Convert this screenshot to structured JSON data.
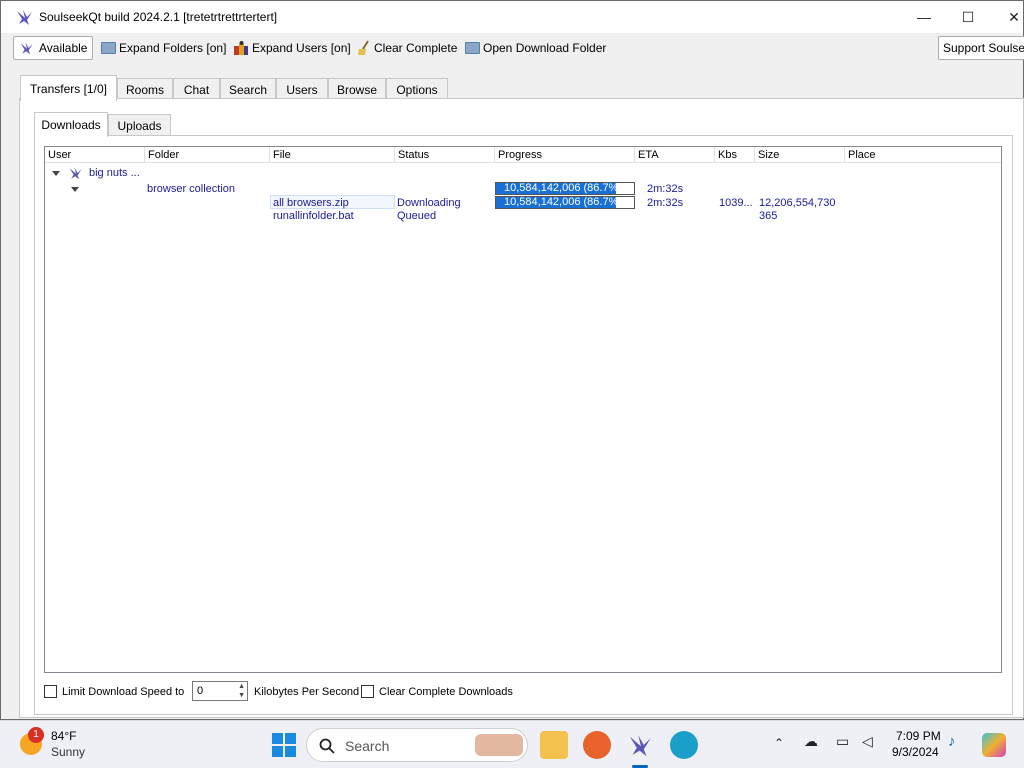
{
  "window": {
    "title": "SoulseekQt build 2024.2.1 [tretetrtrettrtertert]",
    "minimize": "—",
    "maximize": "☐",
    "close": "✕"
  },
  "toolbar": {
    "available": "Available",
    "expand_folders": "Expand Folders [on]",
    "expand_users": "Expand Users [on]",
    "clear_complete": "Clear Complete",
    "open_download_folder": "Open Download Folder",
    "support": "Support Soulseek"
  },
  "tabs": [
    "Transfers [1/0]",
    "Rooms",
    "Chat",
    "Search",
    "Users",
    "Browse",
    "Options"
  ],
  "subtabs": [
    "Downloads",
    "Uploads"
  ],
  "columns": [
    "User",
    "Folder",
    "File",
    "Status",
    "Progress",
    "ETA",
    "Kbs",
    "Size",
    "Place"
  ],
  "transfers": {
    "user": "big nuts ...",
    "folder": "browser collection",
    "folder_progress": "10,584,142,006 (86.7%)",
    "folder_progress_value": 0.867,
    "folder_eta": "2m:32s",
    "files": [
      {
        "file": "all browsers.zip",
        "status": "Downloading",
        "progress": "10,584,142,006 (86.7%)",
        "progress_value": 0.867,
        "eta": "2m:32s",
        "kbs": "1039...",
        "size": "12,206,554,730"
      },
      {
        "file": "runallinfolder.bat",
        "status": "Queued",
        "progress": "",
        "eta": "",
        "kbs": "",
        "size": "365"
      }
    ]
  },
  "bottom": {
    "limit_label": "Limit Download Speed to",
    "limit_value": "0",
    "units": "Kilobytes Per Second",
    "clear_label": "Clear Complete Downloads"
  },
  "taskbar": {
    "weather_temp": "84°F",
    "weather_desc": "Sunny",
    "weather_badge": "1",
    "search_placeholder": "Search",
    "time": "7:09 PM",
    "date": "9/3/2024"
  },
  "colors": {
    "link": "#1a1a9a",
    "progress": "#1870d5",
    "accent": "#0067c0"
  }
}
